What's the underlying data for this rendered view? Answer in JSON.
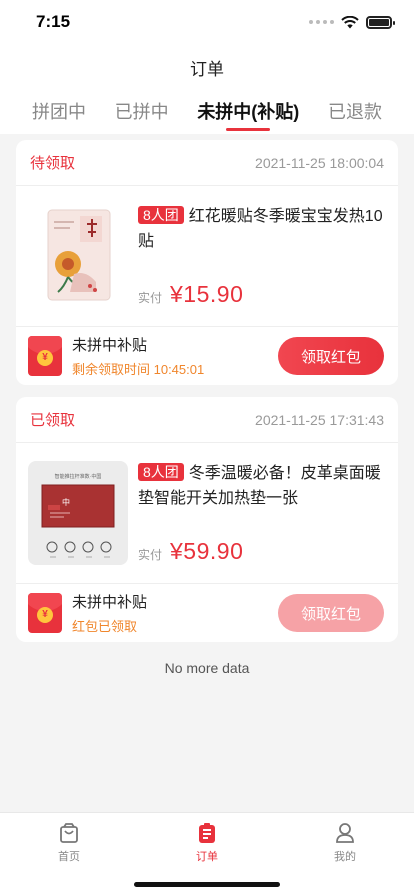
{
  "status_bar": {
    "time": "7:15"
  },
  "nav": {
    "title": "订单"
  },
  "tabs": [
    {
      "label": "拼团中",
      "active": false
    },
    {
      "label": "已拼中",
      "active": false
    },
    {
      "label": "未拼中(补贴)",
      "active": true
    },
    {
      "label": "已退款",
      "active": false
    }
  ],
  "orders": [
    {
      "status": "待领取",
      "time": "2021-11-25 18:00:04",
      "badge": "8人团",
      "title": "红花暖贴冬季暖宝宝发热10贴",
      "pay_label": "实付",
      "price": "¥15.90",
      "bonus_title": "未拼中补贴",
      "bonus_sub": "剩余领取时间 10:45:01",
      "button": "领取红包",
      "button_enabled": true
    },
    {
      "status": "已领取",
      "time": "2021-11-25 17:31:43",
      "badge": "8人团",
      "title": "冬季温暖必备！皮革桌面暖垫智能开关加热垫一张",
      "pay_label": "实付",
      "price": "¥59.90",
      "bonus_title": "未拼中补贴",
      "bonus_sub": "红包已领取",
      "button": "领取红包",
      "button_enabled": false,
      "thumb_text": "智能推拉杆准数·中国",
      "thumb_logo": "中"
    }
  ],
  "footer": {
    "no_more": "No more data"
  },
  "tabbar": [
    {
      "label": "首页",
      "icon": "shopping-bag-icon",
      "active": false
    },
    {
      "label": "订单",
      "icon": "order-list-icon",
      "active": true
    },
    {
      "label": "我的",
      "icon": "user-icon",
      "active": false
    }
  ],
  "colors": {
    "accent": "#e8323c",
    "countdown": "#f0862c"
  }
}
